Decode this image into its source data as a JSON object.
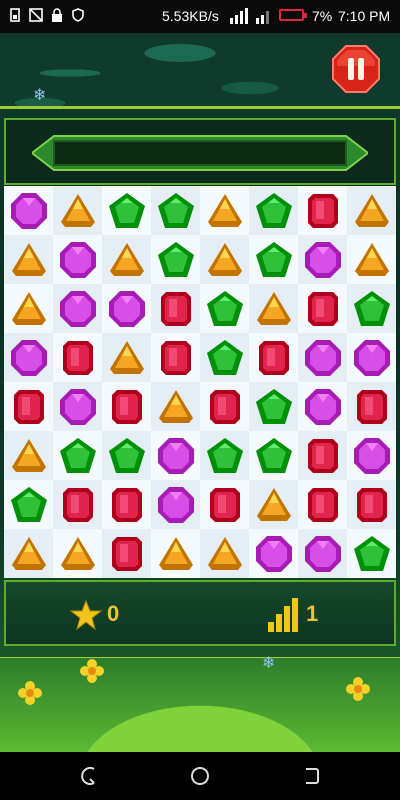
{
  "status_bar": {
    "network_speed": "5.53KB/s",
    "battery_percent": "7%",
    "time": "7:10 PM",
    "icons": [
      "sim-icon",
      "no-signal-icon",
      "lock-icon",
      "shield-icon",
      "signal-icon",
      "battery-icon"
    ]
  },
  "game": {
    "score": "0",
    "level": "1",
    "board": {
      "columns": 8,
      "rows": 8,
      "gems": [
        [
          "purple",
          "orange",
          "green",
          "green",
          "orange",
          "green",
          "red",
          "orange"
        ],
        [
          "orange",
          "purple",
          "orange",
          "green",
          "orange",
          "green",
          "purple",
          "orange"
        ],
        [
          "orange",
          "purple",
          "purple",
          "red",
          "green",
          "orange",
          "red",
          "green"
        ],
        [
          "purple",
          "red",
          "orange",
          "red",
          "green",
          "red",
          "purple",
          "purple"
        ],
        [
          "red",
          "purple",
          "red",
          "orange",
          "red",
          "green",
          "purple",
          "red"
        ],
        [
          "orange",
          "green",
          "green",
          "purple",
          "green",
          "green",
          "red",
          "purple"
        ],
        [
          "green",
          "red",
          "red",
          "purple",
          "red",
          "orange",
          "red",
          "red"
        ],
        [
          "orange",
          "orange",
          "red",
          "orange",
          "orange",
          "purple",
          "purple",
          "green"
        ]
      ]
    },
    "colors": {
      "red": "#e0244d",
      "orange": "#f5a623",
      "green": "#2fc13a",
      "purple": "#d84ee6"
    }
  },
  "nav_bar": {
    "buttons": [
      "back-button",
      "home-button",
      "recents-button"
    ]
  }
}
